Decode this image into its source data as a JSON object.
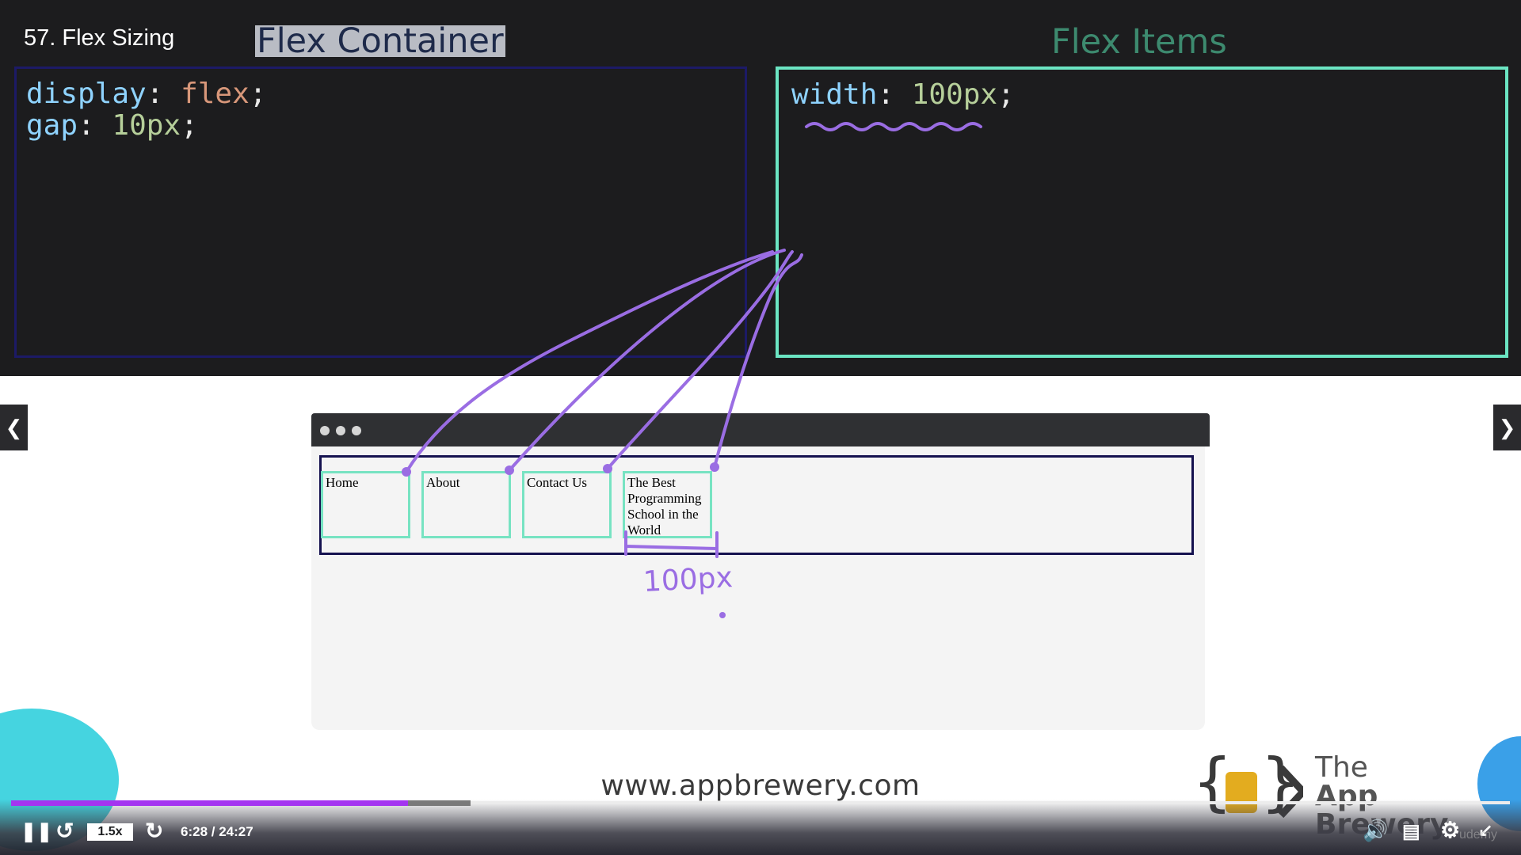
{
  "lesson": {
    "title": "57. Flex Sizing"
  },
  "slide": {
    "container_header": "Flex Container",
    "items_header": "Flex Items",
    "container_code": [
      {
        "prop": "display",
        "value": "flex"
      },
      {
        "prop": "gap",
        "value": "10px"
      }
    ],
    "items_code": [
      {
        "prop": "width",
        "value": "100px"
      }
    ],
    "nav_items": [
      "Home",
      "About",
      "Contact Us",
      "The Best Programming School in the World"
    ],
    "annotation": "100px",
    "url": "www.appbrewery.com",
    "brand_line1": "The",
    "brand_line2": "App Brewery"
  },
  "player": {
    "speed": "1.5x",
    "time": "6:28 / 24:27",
    "progress": 0.265,
    "watermark": "udemy",
    "accent_color": "#a435f0"
  },
  "colors": {
    "code_keyword": "#8fd3ff",
    "code_value_keyword": "#d8977a",
    "code_value_number": "#b6cf9a",
    "items_border": "#6be5c3",
    "annotation_ink": "#9a6de3"
  }
}
